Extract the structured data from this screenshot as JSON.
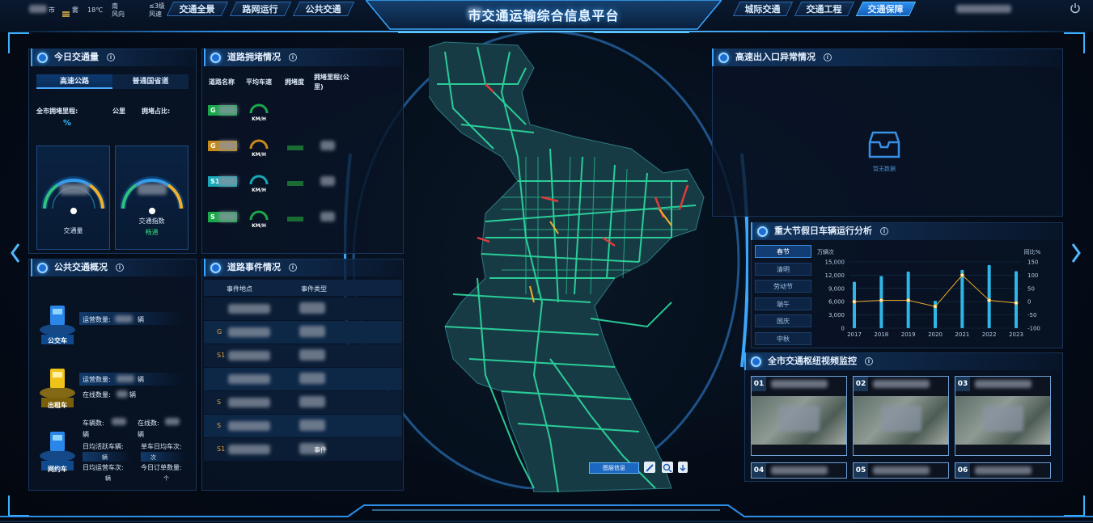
{
  "header": {
    "title": "市交通运输综合信息平台",
    "weather": {
      "city": "市",
      "condition": "雾",
      "temp": "18℃",
      "wind_dir_top": "南",
      "wind_dir_bottom": "风向",
      "wind_level_top": "≤3级",
      "wind_level_bottom": "风速"
    },
    "nav_left": [
      "交通全景",
      "路网运行",
      "公共交通"
    ],
    "nav_right": [
      "城际交通",
      "交通工程",
      "交通保障"
    ],
    "active_nav": "交通保障"
  },
  "today_traffic": {
    "title": "今日交通量",
    "tabs": [
      "高速公路",
      "普通国省道"
    ],
    "congestion_mileage_label": "全市拥堵里程:",
    "mileage_unit": "公里",
    "congestion_ratio_label": "拥堵占比:",
    "percent_symbol": "%",
    "gauges": [
      {
        "label": "交通量",
        "status": ""
      },
      {
        "label": "交通指数",
        "status": "畅通"
      }
    ]
  },
  "road_congestion": {
    "title": "道路拥堵情况",
    "columns": [
      "道路名称",
      "平均车速",
      "拥堵度",
      "拥堵里程(公里)"
    ],
    "rows": [
      {
        "code": "G",
        "unit": "KM/H",
        "color": "#18a84b"
      },
      {
        "code": "G",
        "unit": "KM/H",
        "color": "#c88a18"
      },
      {
        "code": "S1",
        "unit": "KM/H",
        "color": "#18a8b8"
      },
      {
        "code": "S",
        "unit": "KM/H",
        "color": "#1aa84a"
      }
    ]
  },
  "public_transport": {
    "title": "公共交通概况",
    "bus": {
      "name": "公交车",
      "operating_label": "运营数量:",
      "operating_unit": "辆"
    },
    "taxi": {
      "name": "出租车",
      "operating_label": "运营数量:",
      "operating_unit": "辆",
      "online_label": "在线数量:",
      "online_unit": "辆"
    },
    "ride_hailing": {
      "name": "网约车",
      "vehicles_label": "车辆数:",
      "vehicles_unit": "辆",
      "online_label": "在线数:",
      "online_unit": "辆",
      "daily_active_label": "日均活跃车辆:",
      "daily_active_unit": "辆",
      "per_vehicle_label": "单车日均车次:",
      "per_vehicle_unit": "次",
      "daily_trips_label": "日均运营车次:",
      "daily_trips_unit": "辆",
      "daily_orders_label": "今日订单数量:",
      "daily_orders_unit": "个"
    }
  },
  "road_events": {
    "title": "道路事件情况",
    "columns": [
      "事件地点",
      "事件类型"
    ],
    "rows": [
      {
        "location": "",
        "type": ""
      },
      {
        "location": "G",
        "type": ""
      },
      {
        "location": "S1",
        "type": ""
      },
      {
        "location": "",
        "type": ""
      },
      {
        "location": "S",
        "type": ""
      },
      {
        "location": "S",
        "type": ""
      },
      {
        "location": "S1",
        "type": "事件"
      }
    ]
  },
  "map": {
    "controls": {
      "layer_info": "图层信息"
    }
  },
  "highway_exit": {
    "title": "高速出入口异常情况",
    "empty_text": "暂无数据"
  },
  "holiday_analysis": {
    "title": "重大节假日车辆运行分析",
    "holidays": [
      "春节",
      "清明",
      "劳动节",
      "端午",
      "国庆",
      "中秋"
    ],
    "active": "春节"
  },
  "chart_data": {
    "type": "bar",
    "categories": [
      "2017",
      "2018",
      "2019",
      "2020",
      "2021",
      "2022",
      "2023"
    ],
    "series": [
      {
        "type": "bar",
        "axis": "left",
        "values": [
          10500,
          11800,
          12800,
          6200,
          13200,
          14300,
          12900
        ]
      },
      {
        "type": "line",
        "axis": "right",
        "values": [
          0,
          5,
          5,
          -18,
          100,
          5,
          -5
        ]
      }
    ],
    "left_axis": {
      "label": "万辆次",
      "ticks": [
        0,
        3000,
        6000,
        9000,
        12000,
        15000
      ],
      "tick_labels": [
        "0",
        "3,000",
        "6,000",
        "9,000",
        "12,000",
        "15,000"
      ],
      "ylim": [
        0,
        15000
      ]
    },
    "right_axis": {
      "label": "同比%",
      "ticks": [
        -100,
        -50,
        0,
        50,
        100,
        150
      ],
      "ylim": [
        -100,
        150
      ]
    },
    "colors": {
      "bar": "#2fb6e8",
      "line": "#f0a928"
    }
  },
  "video_monitor": {
    "title": "全市交通枢纽视频监控",
    "tiles": [
      "01",
      "02",
      "03",
      "04",
      "05",
      "06"
    ]
  }
}
